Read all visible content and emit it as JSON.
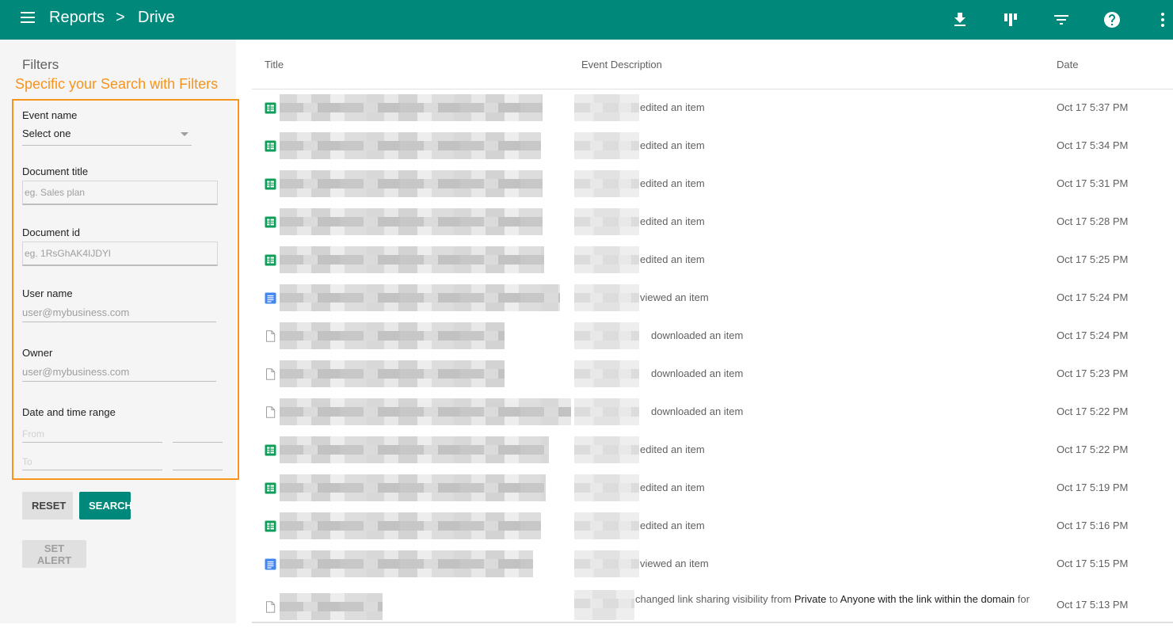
{
  "header": {
    "breadcrumb": [
      "Reports",
      "Drive"
    ],
    "separator": ">",
    "icons": [
      "menu-icon",
      "download-icon",
      "columns-icon",
      "filter-icon",
      "help-icon",
      "more-vert-icon"
    ],
    "bar_color": "#00897b"
  },
  "sidebar": {
    "title": "Filters",
    "annotation": "Specific your Search with Filters",
    "annotation_color": "#f7941d",
    "event_name": {
      "label": "Event name",
      "value": "Select one"
    },
    "document_title": {
      "label": "Document title",
      "placeholder": "eg. Sales plan"
    },
    "document_id": {
      "label": "Document id",
      "placeholder": "eg. 1RsGhAK4IJDYl"
    },
    "user_name": {
      "label": "User name",
      "placeholder": "user@mybusiness.com"
    },
    "owner": {
      "label": "Owner",
      "placeholder": "user@mybusiness.com"
    },
    "date_range": {
      "label": "Date and time range",
      "from_placeholder": "From",
      "to_placeholder": "To"
    },
    "buttons": {
      "reset": "RESET",
      "search": "SEARCH",
      "set_alert": "SET ALERT"
    }
  },
  "table": {
    "columns": [
      "Title",
      "Event Description",
      "Date"
    ],
    "rows": [
      {
        "icon": "sheets-icon",
        "description": "edited an item",
        "date": "Oct 17  5:37 PM"
      },
      {
        "icon": "sheets-icon",
        "description": "edited an item",
        "date": "Oct 17  5:34 PM"
      },
      {
        "icon": "sheets-icon",
        "description": "edited an item",
        "date": "Oct 17  5:31 PM"
      },
      {
        "icon": "sheets-icon",
        "description": "edited an item",
        "date": "Oct 17  5:28 PM"
      },
      {
        "icon": "sheets-icon",
        "description": "edited an item",
        "date": "Oct 17  5:25 PM"
      },
      {
        "icon": "docs-icon",
        "description": "viewed an item",
        "date": "Oct 17  5:24 PM"
      },
      {
        "icon": "file-icon",
        "description": "downloaded an item",
        "date": "Oct 17  5:24 PM"
      },
      {
        "icon": "file-icon",
        "description": "downloaded an item",
        "date": "Oct 17  5:23 PM"
      },
      {
        "icon": "file-icon",
        "description": "downloaded an item",
        "date": "Oct 17  5:22 PM"
      },
      {
        "icon": "sheets-icon",
        "description": "edited an item",
        "date": "Oct 17  5:22 PM"
      },
      {
        "icon": "sheets-icon",
        "description": "edited an item",
        "date": "Oct 17  5:19 PM"
      },
      {
        "icon": "sheets-icon",
        "description": "edited an item",
        "date": "Oct 17  5:16 PM"
      },
      {
        "icon": "docs-icon",
        "description": "viewed an item",
        "date": "Oct 17  5:15 PM"
      }
    ],
    "last_row": {
      "icon": "file-icon",
      "desc_prefix": "changed link sharing visibility from ",
      "from_value": "Private",
      "desc_mid": " to ",
      "to_value": "Anyone with the link within the domain",
      "desc_suffix": " for",
      "date": "Oct 17  5:13 PM"
    }
  }
}
